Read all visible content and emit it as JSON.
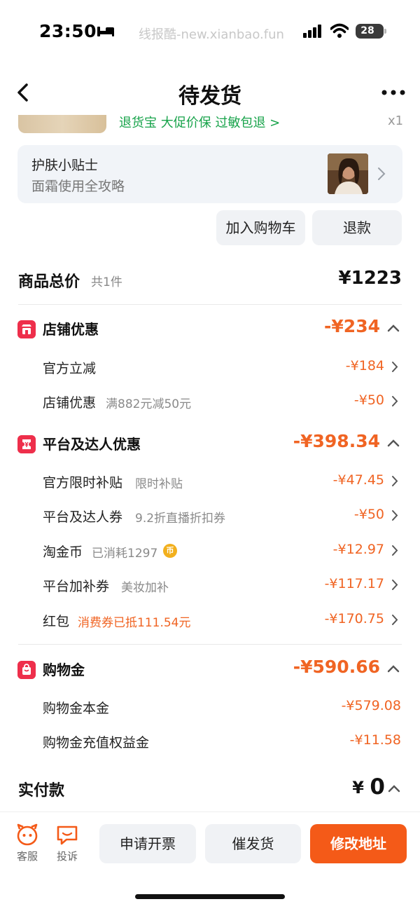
{
  "status_bar": {
    "time": "23:50",
    "watermark": "线报酷-new.xianbao.fun",
    "battery": "28"
  },
  "nav": {
    "title": "待发货"
  },
  "product": {
    "service_tags": "退货宝  大促价保  过敏包退 >",
    "quantity": "x1"
  },
  "tips": {
    "title": "护肤小贴士",
    "subtitle": "面霜使用全攻略"
  },
  "actions": {
    "add_to_cart": "加入购物车",
    "refund": "退款"
  },
  "summary": {
    "label": "商品总价",
    "count": "共1件",
    "value": "¥1223"
  },
  "sections": {
    "store": {
      "title": "店铺优惠",
      "amount": "-¥234",
      "rows": [
        {
          "label": "官方立减",
          "note": "",
          "amount": "-¥184"
        },
        {
          "label": "店铺优惠",
          "note": "满882元减50元",
          "amount": "-¥50"
        }
      ]
    },
    "platform": {
      "title": "平台及达人优惠",
      "amount": "-¥398.34",
      "rows": [
        {
          "label": "官方限时补贴",
          "note": "限时补贴",
          "amount": "-¥47.45"
        },
        {
          "label": "平台及达人券",
          "note": "9.2折直播折扣券",
          "amount": "-¥50"
        },
        {
          "label": "淘金币",
          "note": "已消耗1297",
          "amount": "-¥12.97",
          "badge": "币"
        },
        {
          "label": "平台加补券",
          "note": "美妆加补",
          "amount": "-¥117.17"
        },
        {
          "label": "红包",
          "note": "消费券已抵111.54元",
          "amount": "-¥170.75"
        }
      ]
    },
    "shopping_gold": {
      "title": "购物金",
      "amount": "-¥590.66",
      "rows": [
        {
          "label": "购物金本金",
          "amount": "-¥579.08"
        },
        {
          "label": "购物金充值权益金",
          "amount": "-¥11.58"
        }
      ]
    }
  },
  "paid": {
    "label": "实付款",
    "currency": "¥",
    "value": "0"
  },
  "bottom": {
    "service": "客服",
    "complaint": "投诉",
    "invoice": "申请开票",
    "urge": "催发货",
    "modify_address": "修改地址"
  },
  "colors": {
    "accent": "#f06423",
    "primary_button": "#f45a18",
    "section_icon": "#ee2f4b",
    "tag_green": "#17a34a"
  }
}
